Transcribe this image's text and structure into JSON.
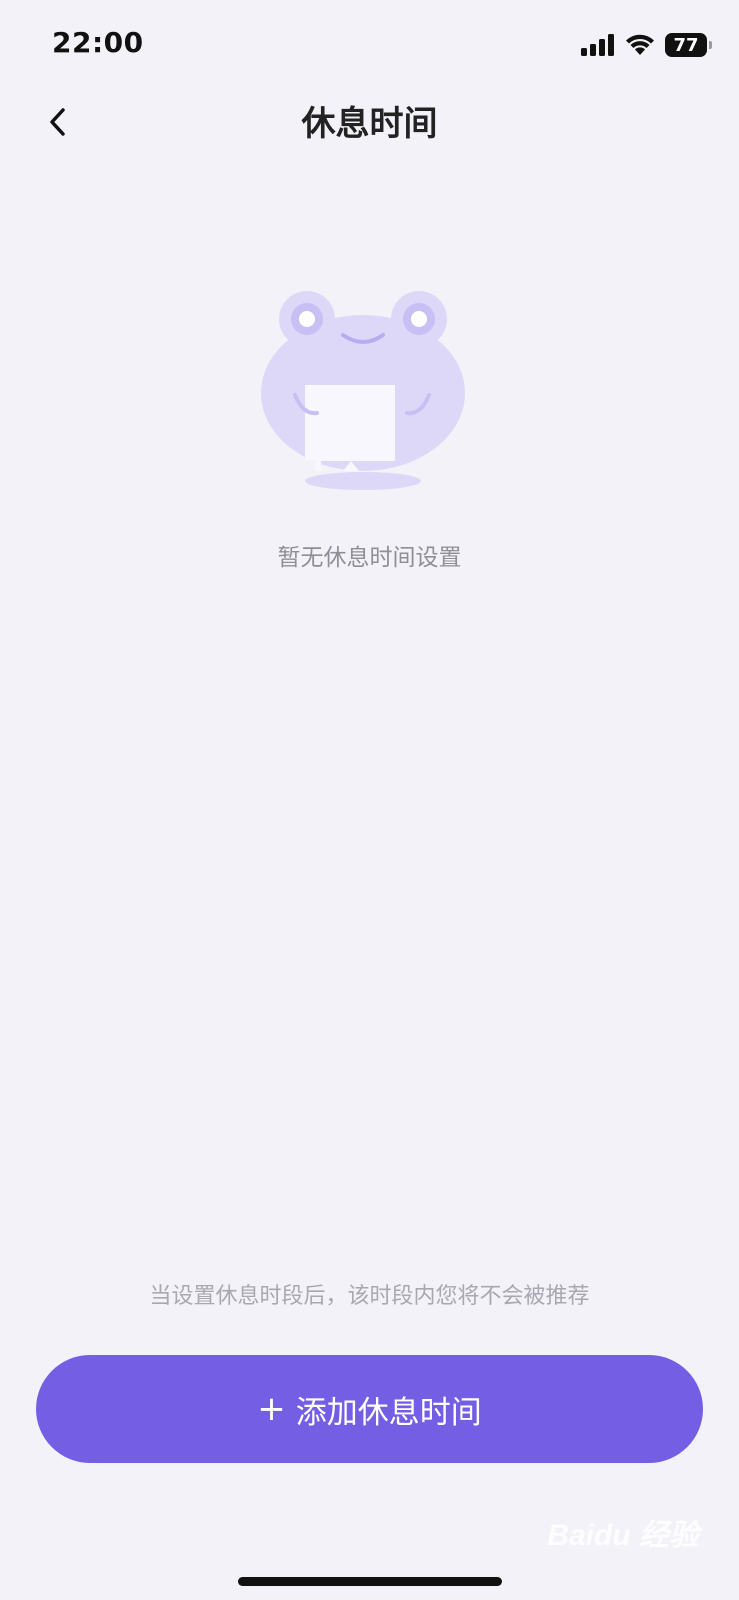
{
  "status_bar": {
    "time": "22:00",
    "battery": "77",
    "signal_icon": "cellular-signal-icon",
    "wifi_icon": "wifi-icon"
  },
  "nav": {
    "back_icon": "chevron-left-icon",
    "title": "休息时间"
  },
  "empty_state": {
    "illustration": "frog-mascot-illustration",
    "message": "暂无休息时间设置"
  },
  "footer": {
    "hint": "当设置休息时段后，该时段内您将不会被推荐",
    "add_button_plus": "+",
    "add_button_label": "添加休息时间"
  },
  "watermark": {
    "text": "Baidu 经验"
  },
  "colors": {
    "background": "#f3f2f9",
    "accent": "#745fe4",
    "mascot": "#ddd8f8"
  }
}
